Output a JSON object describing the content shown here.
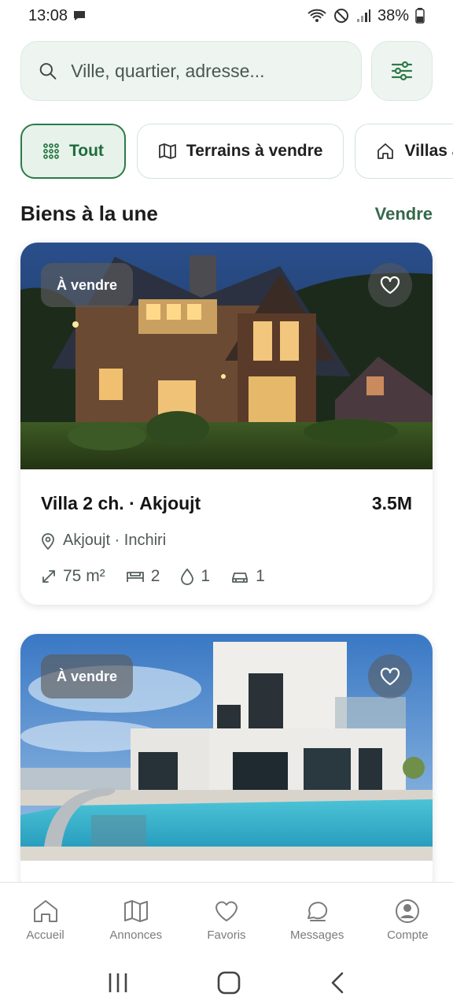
{
  "status": {
    "time": "13:08",
    "battery": "38%"
  },
  "search": {
    "placeholder": "Ville, quartier, adresse..."
  },
  "chips": [
    {
      "label": "Tout",
      "active": true
    },
    {
      "label": "Terrains à vendre",
      "active": false
    },
    {
      "label": "Villas à vendre",
      "active": false
    }
  ],
  "section": {
    "title": "Biens à la une",
    "action": "Vendre"
  },
  "listings": [
    {
      "badge": "À vendre",
      "title": "Villa 2 ch. · Akjoujt",
      "price": "3.5M",
      "location": "Akjoujt · Inchiri",
      "area": "75 m²",
      "bedrooms": "2",
      "bathrooms": "1",
      "parking": "1"
    },
    {
      "badge": "À vendre"
    }
  ],
  "nav": {
    "home": "Accueil",
    "listings": "Annonces",
    "favorites": "Favoris",
    "messages": "Messages",
    "account": "Compte"
  },
  "colors": {
    "accent": "#2e7a48",
    "chip_bg": "#e6f2ea",
    "search_bg": "#eef5f1"
  }
}
